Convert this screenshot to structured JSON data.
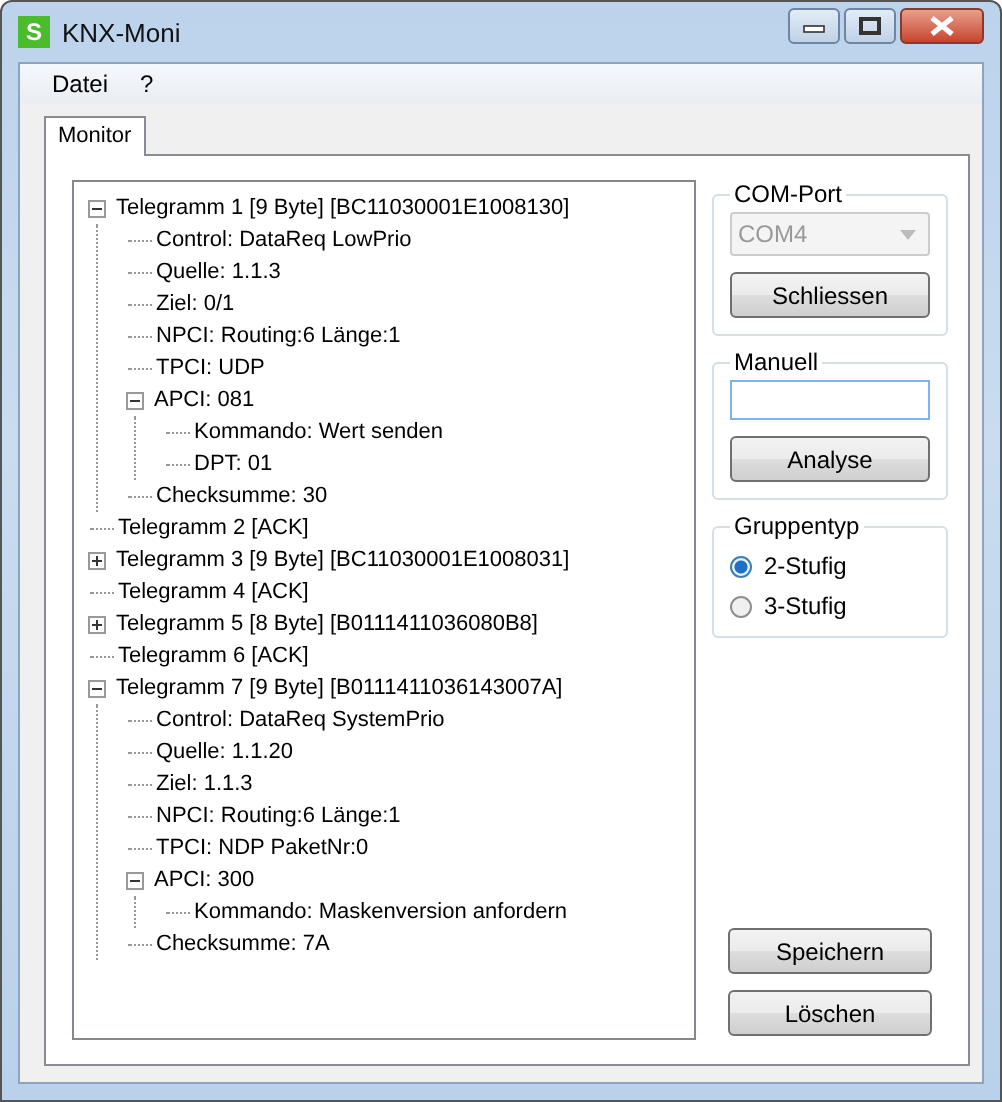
{
  "window": {
    "title": "KNX-Moni",
    "icon_text": "S"
  },
  "menu": [
    "Datei",
    "?"
  ],
  "tabs": [
    {
      "label": "Monitor",
      "selected": true
    }
  ],
  "tree": [
    {
      "label": "Telegramm 1 [9 Byte] [BC11030001E1008130]",
      "expanded": true,
      "children": [
        {
          "label": "Control: DataReq LowPrio"
        },
        {
          "label": "Quelle: 1.1.3"
        },
        {
          "label": "Ziel: 0/1"
        },
        {
          "label": "NPCI: Routing:6 Länge:1"
        },
        {
          "label": "TPCI: UDP"
        },
        {
          "label": "APCI: 081",
          "expanded": true,
          "children": [
            {
              "label": "Kommando: Wert senden"
            },
            {
              "label": "DPT: 01"
            }
          ]
        },
        {
          "label": "Checksumme: 30"
        }
      ]
    },
    {
      "label": "Telegramm 2 [ACK]"
    },
    {
      "label": "Telegramm 3 [9 Byte] [BC11030001E1008031]",
      "expanded": false
    },
    {
      "label": "Telegramm 4 [ACK]"
    },
    {
      "label": "Telegramm 5 [8 Byte] [B0111411036080B8]",
      "expanded": false
    },
    {
      "label": "Telegramm 6 [ACK]"
    },
    {
      "label": "Telegramm 7 [9 Byte] [B0111411036143007A]",
      "expanded": true,
      "children": [
        {
          "label": "Control: DataReq SystemPrio"
        },
        {
          "label": "Quelle: 1.1.20"
        },
        {
          "label": "Ziel: 1.1.3"
        },
        {
          "label": "NPCI: Routing:6 Länge:1"
        },
        {
          "label": "TPCI: NDP PaketNr:0"
        },
        {
          "label": "APCI: 300",
          "expanded": true,
          "children": [
            {
              "label": "Kommando: Maskenversion anfordern"
            }
          ]
        },
        {
          "label": "Checksumme: 7A"
        }
      ]
    }
  ],
  "com_port": {
    "title": "COM-Port",
    "port": "COM4",
    "disabled": true,
    "button": "Schliessen"
  },
  "manuell": {
    "title": "Manuell",
    "button": "Analyse"
  },
  "gruppentyp": {
    "title": "Gruppentyp",
    "options": [
      {
        "label": "2-Stufig",
        "selected": true
      },
      {
        "label": "3-Stufig",
        "selected": false
      }
    ]
  },
  "buttons": [
    "Speichern",
    "Löschen"
  ]
}
